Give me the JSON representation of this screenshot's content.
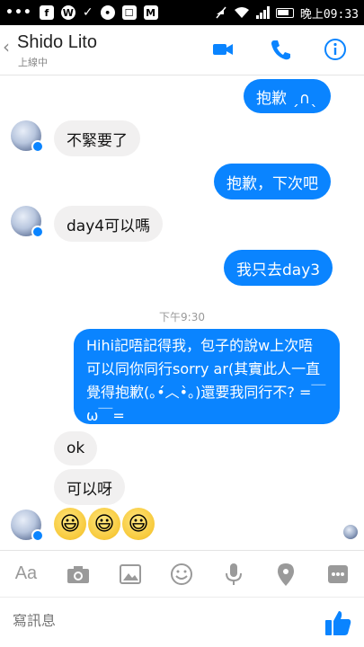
{
  "statusbar": {
    "dots": "•••",
    "app_icons": [
      "f",
      "W",
      "✓",
      "•",
      "☐",
      "M"
    ],
    "time": "晚上09:33"
  },
  "header": {
    "name": "Shido Lito",
    "status": "上線中",
    "back": "‹"
  },
  "messages": [
    {
      "side": "out",
      "text": "抱歉 ˏ∩ˎ"
    },
    {
      "side": "in",
      "text": "不緊要了"
    },
    {
      "side": "out",
      "text": "抱歉，下次吧"
    },
    {
      "side": "in",
      "text": "day4可以嗎"
    },
    {
      "side": "out",
      "text": "我只去day3"
    },
    {
      "side": "out",
      "text": "Hihi記唔記得我，包子的說w上次唔可以同你同行sorry ar(其實此人一直覺得抱歉(｡•́︿•̀｡)還要我同行不?  =￣ω￣="
    },
    {
      "side": "in",
      "text": "ok"
    },
    {
      "side": "in",
      "text": "可以呀"
    }
  ],
  "timestamp": "下午9:30",
  "emoji_reaction": [
    "😃",
    "😃",
    "😃"
  ],
  "toolbar": {
    "text_label": "Aa"
  },
  "compose": {
    "placeholder": "寫訊息"
  },
  "colors": {
    "accent": "#0a84ff",
    "incoming_bubble": "#f1f0f0"
  }
}
